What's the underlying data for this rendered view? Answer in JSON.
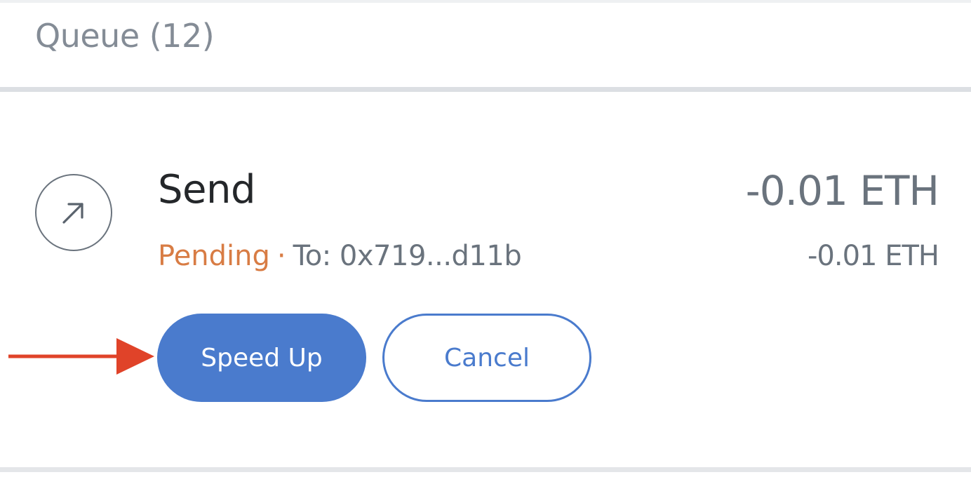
{
  "queue": {
    "header_label": "Queue (12)"
  },
  "transaction": {
    "icon": "arrow-up-right-icon",
    "title": "Send",
    "status": "Pending",
    "separator": "·",
    "to_label": "To: 0x719...d11b",
    "amount_primary": "-0.01 ETH",
    "amount_secondary": "-0.01 ETH",
    "status_color": "#d87c44"
  },
  "actions": {
    "speed_up_label": "Speed Up",
    "cancel_label": "Cancel",
    "accent_color": "#4a7bcd"
  },
  "annotation": {
    "icon": "red-pointer-arrow",
    "color": "#e04329"
  }
}
